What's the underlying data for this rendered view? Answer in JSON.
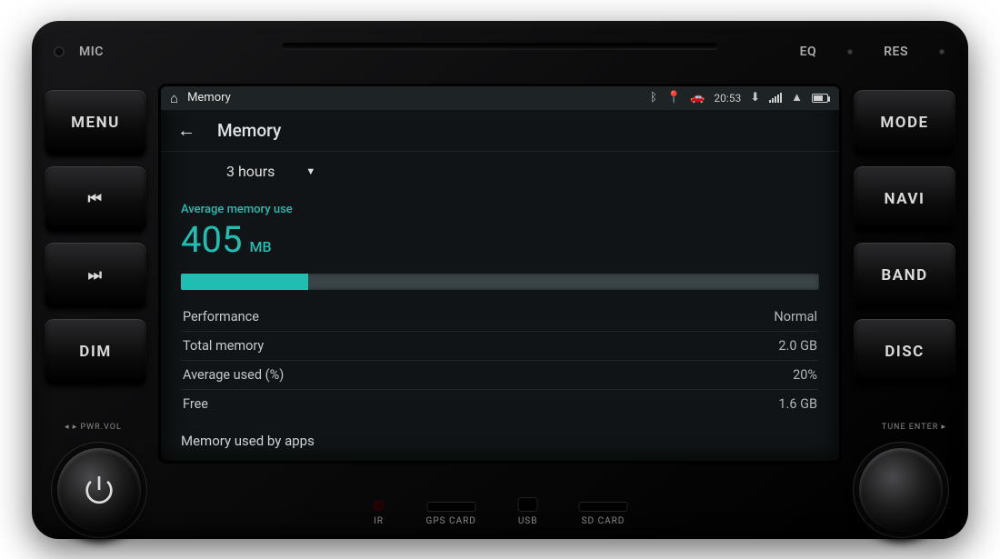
{
  "unit": {
    "top": {
      "mic": "MIC",
      "eq": "EQ",
      "res": "RES"
    },
    "buttons_left": [
      "MENU",
      "⏮",
      "⏭",
      "DIM"
    ],
    "buttons_right": [
      "MODE",
      "NAVI",
      "BAND",
      "DISC"
    ],
    "knobs": {
      "left_label": "◂ ▸ PWR.VOL",
      "right_label": "TUNE ENTER ▸"
    },
    "ports": {
      "ir": "IR",
      "gps": "GPS CARD",
      "usb": "USB",
      "sd": "SD CARD"
    }
  },
  "status_bar": {
    "app_title": "Memory",
    "time": "20:53"
  },
  "screen": {
    "header_title": "Memory",
    "range_label": "3 hours",
    "avg_label": "Average memory use",
    "avg_value": "405",
    "avg_unit": "MB",
    "used_pct": 20,
    "rows": [
      {
        "label": "Performance",
        "value": "Normal"
      },
      {
        "label": "Total memory",
        "value": "2.0 GB"
      },
      {
        "label": "Average used (%)",
        "value": "20%"
      },
      {
        "label": "Free",
        "value": "1.6 GB"
      }
    ],
    "apps_heading": "Memory used by apps"
  },
  "colors": {
    "accent": "#1fbeb0"
  }
}
